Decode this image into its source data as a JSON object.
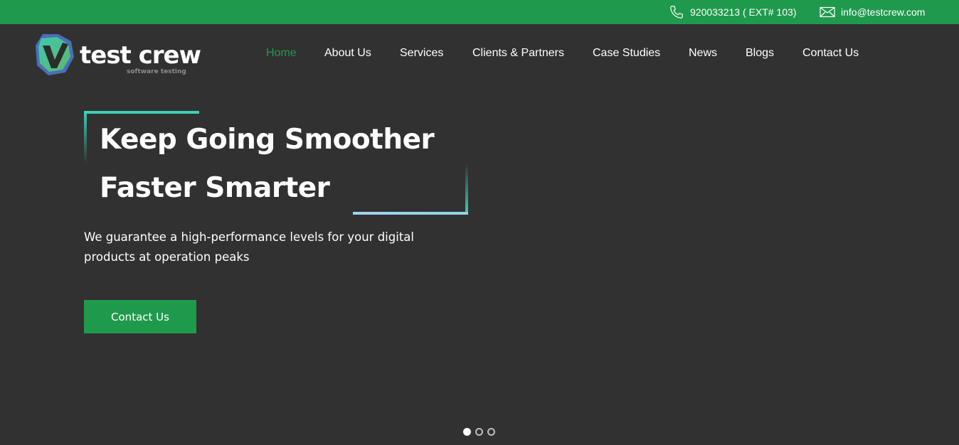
{
  "topbar": {
    "phone": "920033213 ( EXT# 103)",
    "email": "info@testcrew.com",
    "phone_icon": "phone-icon",
    "email_icon": "envelope-icon",
    "background": "#1f9a4d"
  },
  "logo": {
    "wordmark": "test crew",
    "tagline": "software testing"
  },
  "nav": {
    "items": [
      {
        "label": "Home",
        "active": true
      },
      {
        "label": "About Us"
      },
      {
        "label": "Services"
      },
      {
        "label": "Clients & Partners"
      },
      {
        "label": "Case Studies"
      },
      {
        "label": "News"
      },
      {
        "label": "Blogs"
      },
      {
        "label": "Contact Us"
      }
    ]
  },
  "hero": {
    "title_line1": "Keep Going Smoother",
    "title_line2": "Faster Smarter",
    "subtitle": "We guarantee a high-performance levels for your digital products at operation peaks",
    "cta_label": "Contact Us"
  },
  "carousel": {
    "slide_count": 3,
    "active_index": 0
  },
  "colors": {
    "accent": "#1f9a4d",
    "background": "#313131",
    "frame_teal": "#3fcfb4",
    "frame_blue": "#9ed2f0"
  }
}
